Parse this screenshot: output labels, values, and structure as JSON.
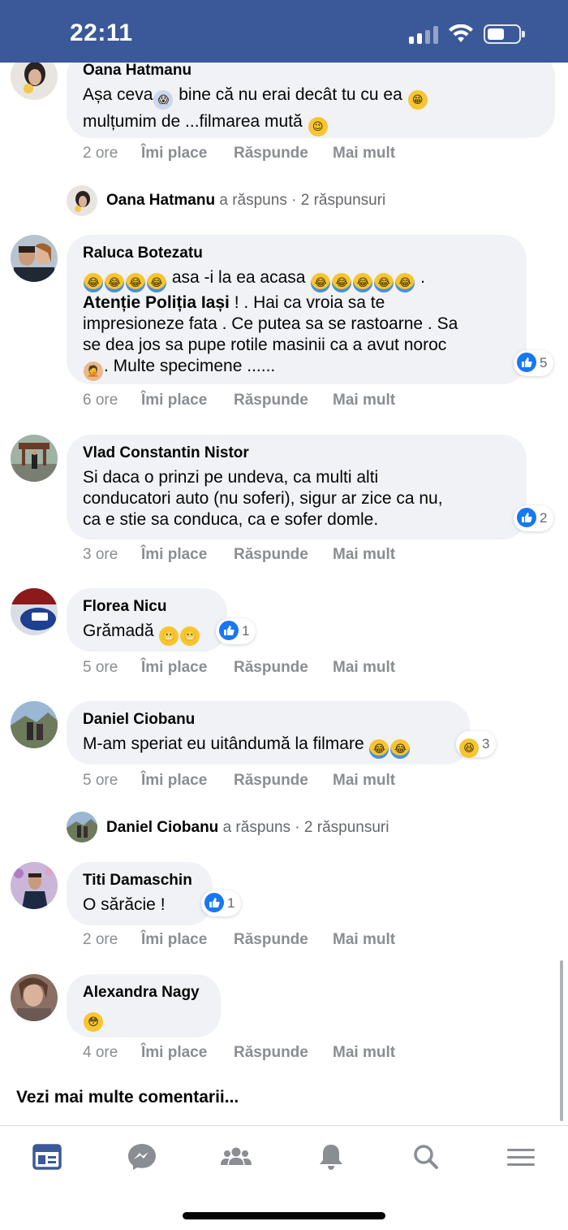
{
  "status_bar": {
    "time": "22:11"
  },
  "comments": [
    {
      "name": "Oana Hatmanu",
      "text_lines": [
        "Așa ceva",
        " bine că nu erai decât tu cu ea ",
        "mulțumim de ...filmarea mută "
      ],
      "age": "2 ore"
    },
    {
      "name": "Raluca Botezatu",
      "text_line1": " asa -i la ea acasa ",
      "text_line1_end": " .",
      "text_bold": "Atenție Poliția Iași",
      "text_line2_rest": " ! . Hai ca vroia sa te",
      "text_line3": "impresioneze fata . Ce putea sa se rastoarne . Sa",
      "text_line4": "se dea jos sa pupe rotile masinii ca a avut noroc",
      "text_line5": ". Multe specimene ......",
      "reactions": "5",
      "age": "6 ore"
    },
    {
      "name": "Vlad Constantin Nistor",
      "text_lines": [
        "Si daca o prinzi pe undeva, ca multi alti",
        "conducatori auto (nu soferi), sigur ar zice ca nu,",
        "ca e stie sa conduca, ca e sofer domle."
      ],
      "reactions": "2",
      "age": "3 ore"
    },
    {
      "name": "Florea Nicu",
      "text": "Grămadă ",
      "reactions": "1",
      "age": "5 ore"
    },
    {
      "name": "Daniel Ciobanu",
      "text": "M-am speriat eu uitândumă la filmare ",
      "reactions": "3",
      "age": "5 ore"
    },
    {
      "name": "Titi Damaschin",
      "text": "O sărăcie !",
      "reactions": "1",
      "age": "2 ore"
    },
    {
      "name": "Alexandra Nagy",
      "age": "4 ore"
    }
  ],
  "actions": {
    "like": "Îmi place",
    "reply": "Răspunde",
    "more": "Mai mult"
  },
  "replies": [
    {
      "name": "Oana Hatmanu",
      "verb": " a răspuns",
      "sep": " · ",
      "count": "2 răspunsuri"
    },
    {
      "name": "Daniel Ciobanu",
      "verb": " a răspuns",
      "sep": " · ",
      "count": "2 răspunsuri"
    }
  ],
  "see_more": "Vezi mai multe comentarii...",
  "tabbar": {
    "tabs": [
      "feed-icon",
      "messenger-icon",
      "groups-icon",
      "notifications-icon",
      "search-icon",
      "menu-icon"
    ],
    "active_color": "#3b5998",
    "inactive_color": "#8a8d91"
  },
  "colors": {
    "header": "#3b5998",
    "like_blue": "#1877f2",
    "bubble": "#f0f2f5"
  }
}
